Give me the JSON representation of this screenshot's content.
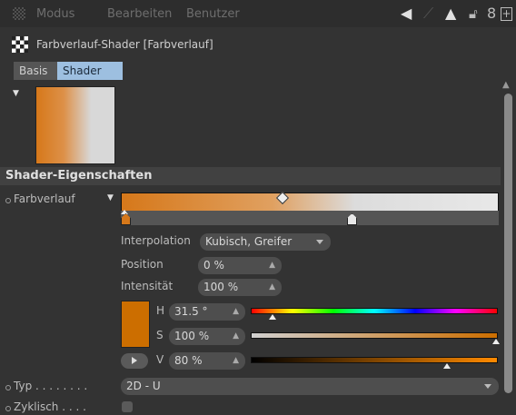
{
  "menubar": {
    "items": [
      "Modus",
      "Bearbeiten",
      "Benutzer"
    ],
    "icons": [
      "arrow-left-icon",
      "arrow-up-icon",
      "lock-icon",
      "link-icon",
      "new-panel-icon"
    ]
  },
  "title": "Farbverlauf-Shader [Farbverlauf]",
  "tabs": [
    {
      "label": "Basis",
      "active": false
    },
    {
      "label": "Shader",
      "active": true
    }
  ],
  "section_title": "Shader-Eigenschaften",
  "gradient": {
    "label": "Farbverlauf",
    "colors": [
      "#d6781a",
      "#dcdcdc"
    ]
  },
  "params": {
    "interpolation_label": "Interpolation",
    "interpolation_value": "Kubisch, Greifer",
    "position_label": "Position",
    "position_value": "0 %",
    "intensity_label": "Intensität",
    "intensity_value": "100 %"
  },
  "color": {
    "swatch": "#cc6e00",
    "h_label": "H",
    "h_value": "31.5 °",
    "h_fraction": 0.0875,
    "s_label": "S",
    "s_value": "100 %",
    "s_fraction": 1.0,
    "v_label": "V",
    "v_value": "80 %",
    "v_fraction": 0.8
  },
  "typ": {
    "label": "Typ . . . . . . . .",
    "value": "2D - U"
  },
  "zyklisch": {
    "label": "Zyklisch . . . .",
    "checked": false
  }
}
